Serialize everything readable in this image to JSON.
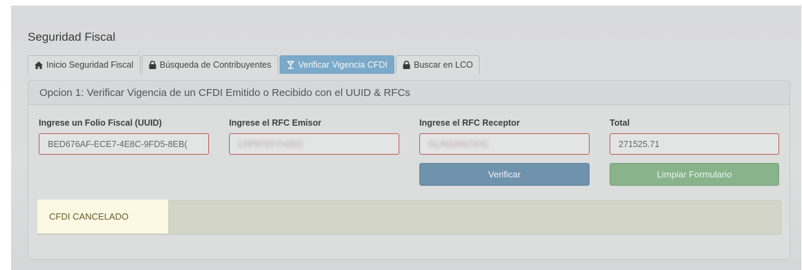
{
  "page": {
    "title": "Seguridad Fiscal"
  },
  "tabs": [
    {
      "label": "Inicio Seguridad Fiscal",
      "icon": "home-icon",
      "active": false
    },
    {
      "label": "Búsqueda de Contribuyentes",
      "icon": "lock-icon",
      "active": false
    },
    {
      "label": "Verificar Vigencia CFDI",
      "icon": "scale-icon",
      "active": true
    },
    {
      "label": "Buscar en LCO",
      "icon": "lock-icon",
      "active": false
    }
  ],
  "panel": {
    "heading": "Opcion 1: Verificar Vigencia de un CFDI Emitido o Recibido con el UUID & RFCs"
  },
  "form": {
    "uuid_label": "Ingrese un Folio Fiscal (UUID)",
    "uuid_value": "BED676AF-ECE7-4E8C-9FD5-8EB(",
    "rfc_emisor_label": "Ingrese el RFC Emisor",
    "rfc_emisor_value": "LDP870YYH2D2",
    "rfc_receptor_label": "Ingrese el RFC Receptor",
    "rfc_receptor_value": "GLIN100674JG",
    "total_label": "Total",
    "total_value": "271525.71"
  },
  "buttons": {
    "verify_label": "Verificar",
    "clear_label": "Limpiar Formulario"
  },
  "result": {
    "text": "CFDI CANCELADO"
  },
  "colors": {
    "active_tab": "#7aa9c9",
    "invalid_border": "#c0585a",
    "primary_button": "#6f92ad",
    "success_button": "#88b38b",
    "highlight": "#fcf8e3"
  }
}
